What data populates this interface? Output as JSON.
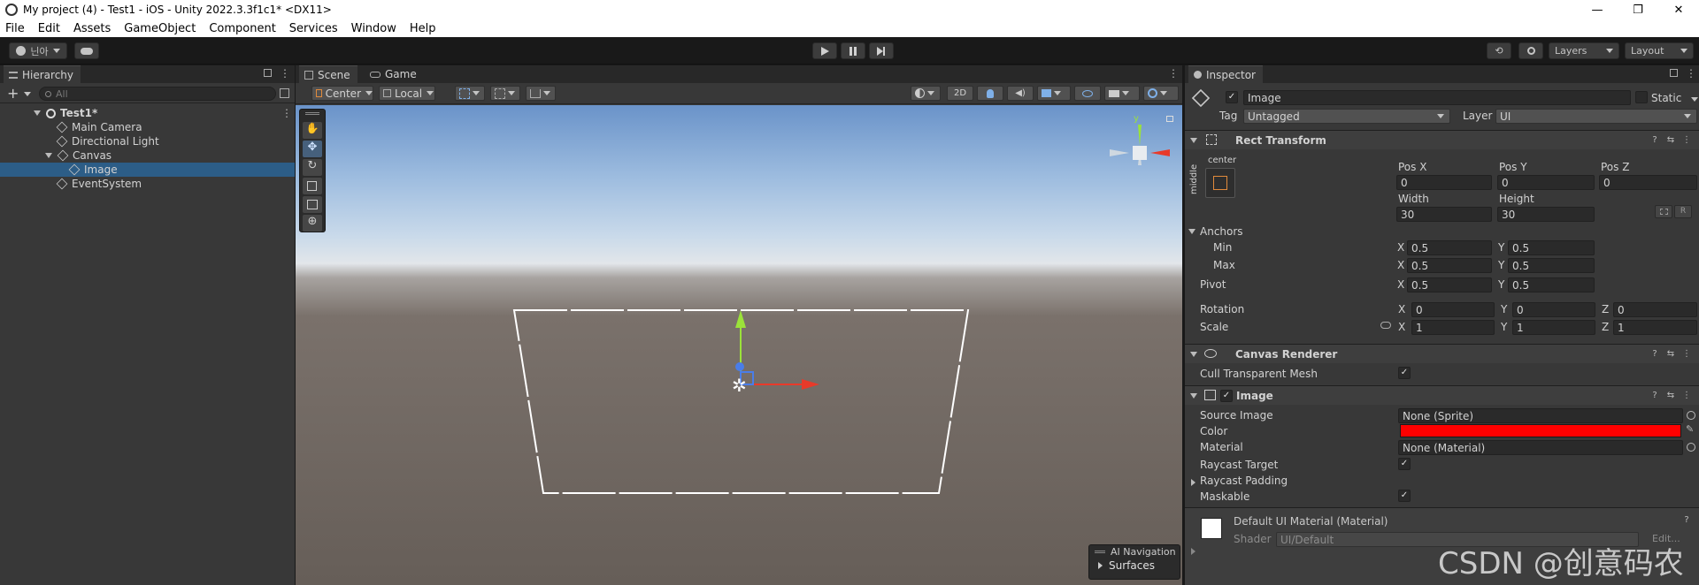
{
  "window": {
    "title": "My project (4) - Test1 - iOS - Unity 2022.3.3f1c1* <DX11>",
    "controls": [
      "—",
      "❐",
      "✕"
    ]
  },
  "menu": [
    "File",
    "Edit",
    "Assets",
    "GameObject",
    "Component",
    "Services",
    "Window",
    "Help"
  ],
  "toolbar": {
    "account": "닌아",
    "layers": "Layers",
    "layout": "Layout"
  },
  "hierarchy": {
    "tab": "Hierarchy",
    "search_placeholder": "All",
    "items": [
      {
        "label": "Test1*",
        "bold": true
      },
      {
        "label": "Main Camera"
      },
      {
        "label": "Directional Light"
      },
      {
        "label": "Canvas"
      },
      {
        "label": "Image",
        "selected": true
      },
      {
        "label": "EventSystem"
      }
    ]
  },
  "scene": {
    "tabs": [
      "Scene",
      "Game"
    ],
    "pivot": "Center",
    "space": "Local",
    "mode2d": "2D",
    "gizmo_y": "y",
    "overlay_title": "AI Navigation",
    "overlay_item": "Surfaces"
  },
  "inspector": {
    "tab": "Inspector",
    "object_name": "Image",
    "static_label": "Static",
    "tag_label": "Tag",
    "tag_value": "Untagged",
    "layer_label": "Layer",
    "layer_value": "UI",
    "rect": {
      "title": "Rect Transform",
      "anchor_h": "center",
      "anchor_v": "middle",
      "posx_label": "Pos X",
      "posx": "0",
      "posy_label": "Pos Y",
      "posy": "0",
      "posz_label": "Pos Z",
      "posz": "0",
      "width_label": "Width",
      "width": "30",
      "height_label": "Height",
      "height": "30",
      "r_button": "R",
      "anchors_label": "Anchors",
      "min_label": "Min",
      "min_x": "0.5",
      "min_y": "0.5",
      "max_label": "Max",
      "max_x": "0.5",
      "max_y": "0.5",
      "pivot_label": "Pivot",
      "pivot_x": "0.5",
      "pivot_y": "0.5",
      "rotation_label": "Rotation",
      "rot_x": "0",
      "rot_y": "0",
      "rot_z": "0",
      "scale_label": "Scale",
      "scale_x": "1",
      "scale_y": "1",
      "scale_z": "1",
      "x": "X",
      "y": "Y",
      "z": "Z"
    },
    "canvas_renderer": {
      "title": "Canvas Renderer",
      "cull_label": "Cull Transparent Mesh"
    },
    "image": {
      "title": "Image",
      "source_label": "Source Image",
      "source_value": "None (Sprite)",
      "color_label": "Color",
      "color_value": "#ff0000",
      "material_label": "Material",
      "material_value": "None (Material)",
      "raycast_label": "Raycast Target",
      "padding_label": "Raycast Padding",
      "maskable_label": "Maskable"
    },
    "material": {
      "title": "Default UI Material (Material)",
      "shader_label": "Shader",
      "shader_value": "UI/Default",
      "edit": "Edit..."
    }
  },
  "watermark": "CSDN @创意码农"
}
